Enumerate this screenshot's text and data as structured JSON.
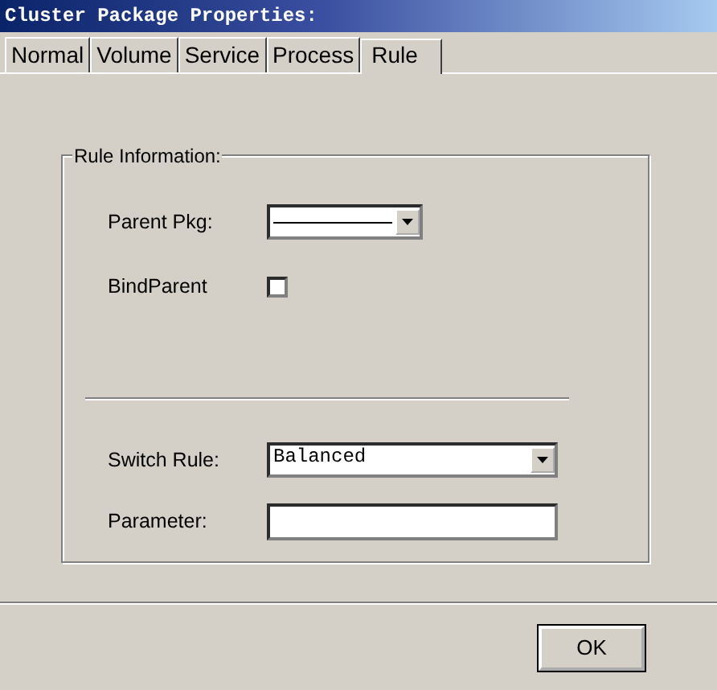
{
  "window": {
    "title": "Cluster Package Properties:"
  },
  "tabs": [
    {
      "label": "Normal",
      "selected": false
    },
    {
      "label": "Volume",
      "selected": false
    },
    {
      "label": "Service",
      "selected": false
    },
    {
      "label": "Process",
      "selected": false
    },
    {
      "label": "Rule",
      "selected": true
    }
  ],
  "group": {
    "title": "Rule Information:",
    "fields": [
      {
        "kind": "combo",
        "label": "Parent Pkg:"
      },
      {
        "kind": "checkbox",
        "label": "BindParent",
        "checked": false
      },
      {
        "kind": "divider"
      },
      {
        "kind": "combo",
        "label": "Switch Rule:",
        "value": "Balanced"
      },
      {
        "kind": "text",
        "label": "Parameter:"
      }
    ]
  },
  "buttons": [
    {
      "label": "OK"
    }
  ]
}
